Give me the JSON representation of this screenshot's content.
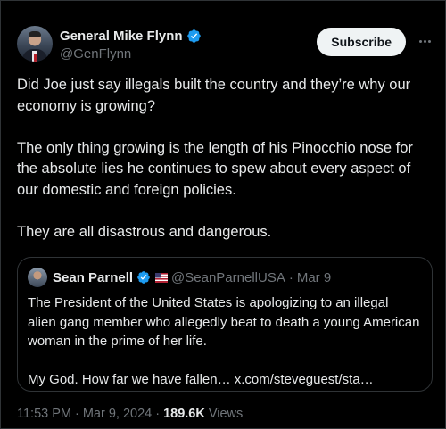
{
  "author": {
    "display_name": "General Mike Flynn",
    "handle": "@GenFlynn"
  },
  "actions": {
    "subscribe_label": "Subscribe",
    "more_icon": "more-horizontal-icon"
  },
  "tweet": {
    "paragraphs": [
      "Did Joe just say illegals built the country and they’re why our economy is growing?",
      "The only thing growing is the length of his Pinocchio nose for the absolute lies he continues to spew about every aspect of our domestic and foreign policies.",
      "They are all disastrous and dangerous."
    ]
  },
  "quoted_tweet": {
    "display_name": "Sean Parnell",
    "handle": "@SeanParnellUSA",
    "separator": "·",
    "date": "Mar 9",
    "paragraphs": [
      "The President of the United States is apologizing to an illegal alien gang member who allegedly beat to death a young American woman in the prime of her life.",
      "My God. How far we have fallen… x.com/steveguest/sta…"
    ]
  },
  "meta": {
    "time": "11:53 PM",
    "separator": "·",
    "date": "Mar 9, 2024",
    "views_count": "189.6K",
    "views_label": "Views"
  },
  "colors": {
    "background": "#000000",
    "text": "#e7e9ea",
    "secondary_text": "#71767b",
    "verified_blue": "#1d9bf0",
    "border": "#2f3336"
  }
}
